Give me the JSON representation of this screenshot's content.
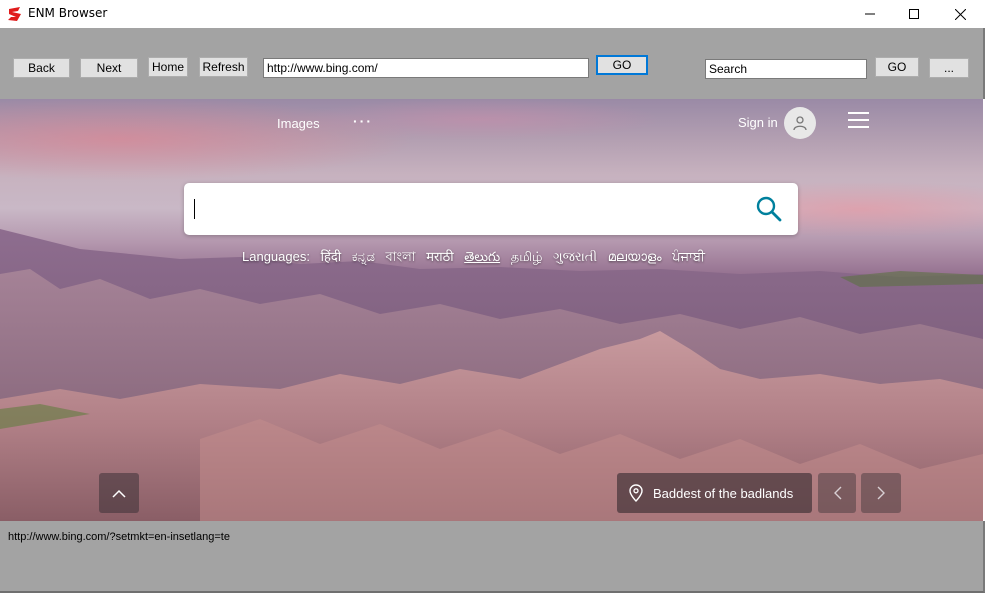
{
  "window": {
    "title": "ENM Browser"
  },
  "toolbar": {
    "back_label": "Back",
    "next_label": "Next",
    "home_label": "Home",
    "refresh_label": "Refresh",
    "address_value": "http://www.bing.com/",
    "go_label": "GO",
    "search_value": "Search",
    "search_go_label": "GO",
    "more_label": "..."
  },
  "page": {
    "nav_images": "Images",
    "nav_more": "···",
    "signin_label": "Sign in",
    "languages_label": "Languages:",
    "languages": [
      "हिंदी",
      "ಕನ್ನಡ",
      "বাংলা",
      "मराठी",
      "తెలుగు",
      "தமிழ்",
      "ગુજરાતી",
      "മലയാളം",
      "ਪੰਜਾਬੀ"
    ],
    "caption": "Baddest of the badlands"
  },
  "status": {
    "text": "http://www.bing.com/?setmkt=en-insetlang=te"
  },
  "colors": {
    "toolbar_bg": "#a3a3a3",
    "focus_accent": "#0078d7",
    "search_icon": "#00809d"
  }
}
